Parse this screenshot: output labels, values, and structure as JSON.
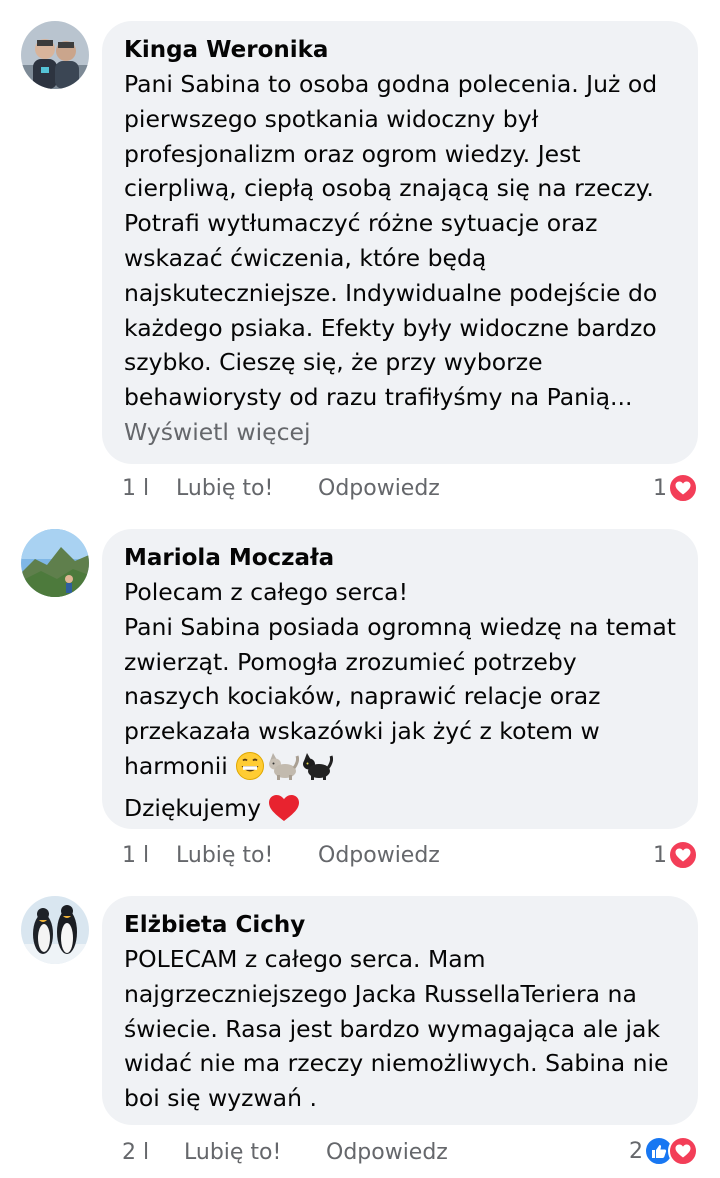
{
  "comments": [
    {
      "author": "Kinga Weronika",
      "text": "Pani Sabina to osoba godna polecenia. Już od pierwszego spotkania widoczny był profesjonalizm oraz ogrom wiedzy. Jest cierpliwą, ciepłą osobą znającą się na rzeczy. Potrafi wytłumaczyć różne sytuacje oraz wskazać ćwiczenia, które będą najskuteczniejsze. Indywidualne podejście do każdego psiaka. Efekty były widoczne bardzo szybko. Cieszę się, że przy wyborze behawiorysty od razu trafiłyśmy na Panią...",
      "see_more": "Wyświetl więcej",
      "time": "1 l",
      "like_label": "Lubię to!",
      "reply_label": "Odpowiedz",
      "reaction_count": "1",
      "reactions": [
        "love-icon"
      ]
    },
    {
      "author": "Mariola Moczała",
      "line1": "Polecam z całego serca!",
      "text": "Pani Sabina posiada ogromną wiedzę na temat zwierząt. Pomogła zrozumieć potrzeby naszych kociaków, naprawić relacje oraz przekazała wskazówki jak żyć z kotem w harmonii",
      "emojis": [
        "grinning-face-icon",
        "cat-icon",
        "black-cat-icon"
      ],
      "thanks": "Dziękujemy",
      "thanks_emoji": "red-heart-icon",
      "time": "1 l",
      "like_label": "Lubię to!",
      "reply_label": "Odpowiedz",
      "reaction_count": "1",
      "reactions": [
        "love-icon"
      ]
    },
    {
      "author": "Elżbieta Cichy",
      "text": "POLECAM z całego serca.  Mam najgrzeczniejszego Jacka RussellaTeriera na świecie. Rasa jest bardzo  wymagająca ale jak widać nie ma rzeczy niemożliwych. Sabina nie boi się wyzwań .",
      "time": "2 l",
      "like_label": "Lubię to!",
      "reply_label": "Odpowiedz",
      "reaction_count": "2",
      "reactions": [
        "like-icon",
        "love-icon"
      ]
    }
  ],
  "colors": {
    "bubble": "#f0f2f5",
    "meta_text": "#65676b",
    "like_blue": "#1877f2",
    "love_red": "#f33e58"
  }
}
